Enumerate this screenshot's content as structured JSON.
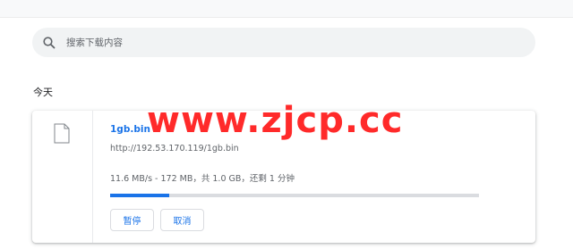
{
  "search": {
    "placeholder": "搜索下载内容"
  },
  "section": {
    "date_header": "今天"
  },
  "download": {
    "file_name": "1gb.bin",
    "url": "http://192.53.170.119/1gb.bin",
    "status": "11.6 MB/s - 172 MB，共 1.0 GB，还剩 1 分钟",
    "progress_fraction": 0.16,
    "pause_label": "暂停",
    "cancel_label": "取消"
  },
  "watermark": {
    "text": "www.zjcp.cc"
  },
  "colors": {
    "accent": "#1a73e8",
    "search_bg": "#f1f3f4",
    "progress_track": "#dadce0",
    "watermark": "#ff2a2a"
  },
  "icons": {
    "search": "search-icon",
    "file": "file-icon"
  }
}
